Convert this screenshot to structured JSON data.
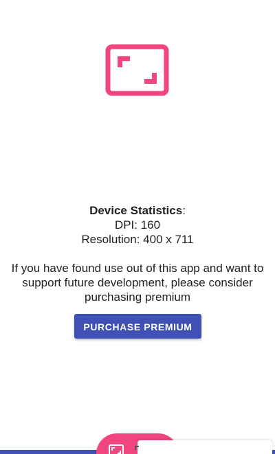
{
  "app": {
    "logo_icon": "fullscreen-frame-icon",
    "accent_color": "#f0457e",
    "primary_color": "#3f51b5"
  },
  "stats": {
    "heading": "Device Statistics",
    "heading_suffix": ":",
    "dpi": "DPI: 160",
    "resolution": "Resolution: 400 x 711"
  },
  "support": {
    "message": "If you have found use out of this app and want to support future development, please consider purchasing premium"
  },
  "purchase": {
    "label": "PURCHASE PREMIUM"
  },
  "fab": {
    "icon": "fullscreen-frame-icon"
  }
}
